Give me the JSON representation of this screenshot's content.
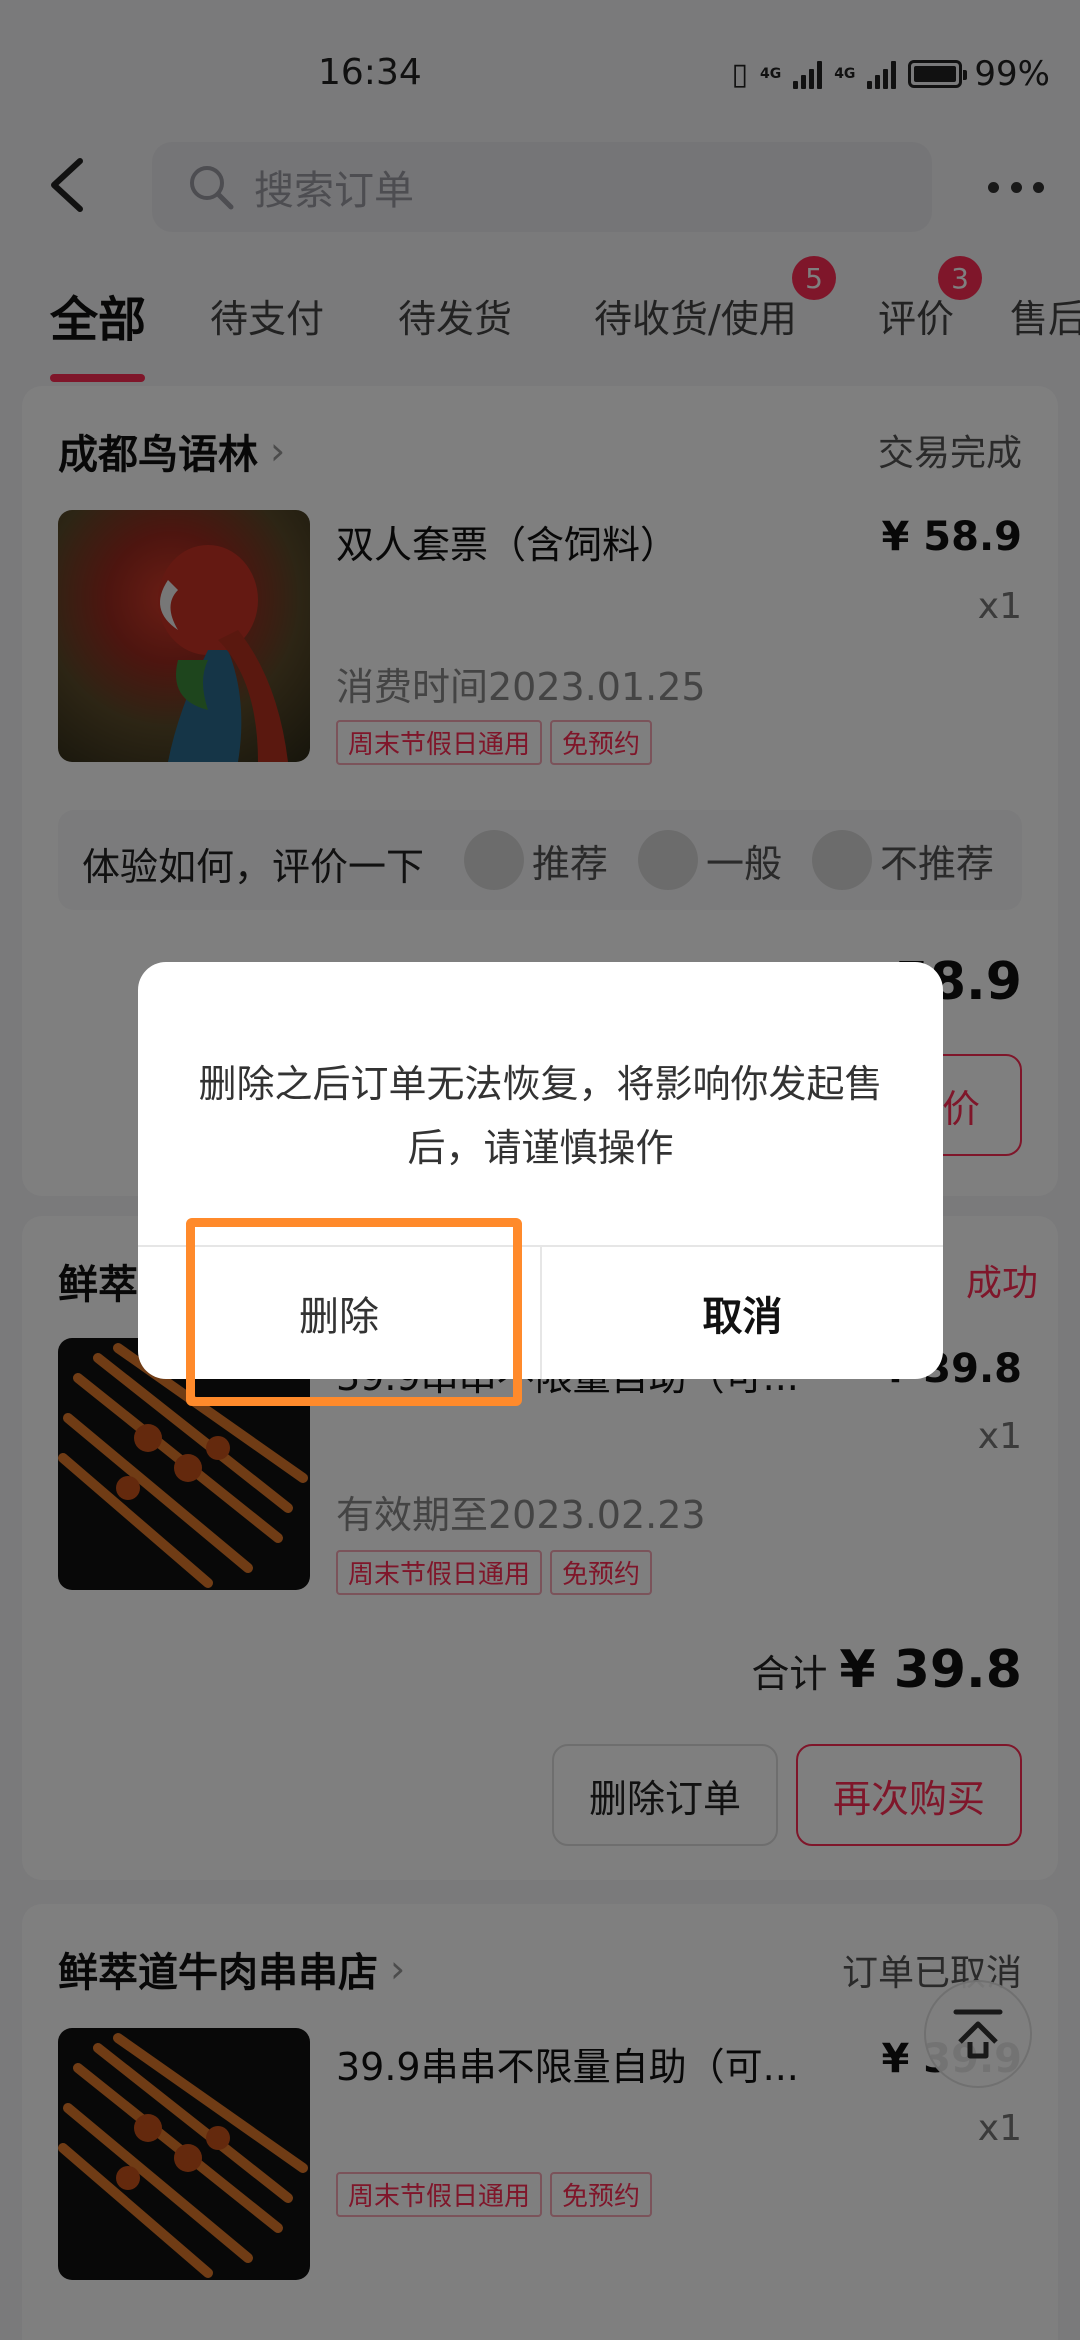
{
  "status_bar": {
    "time": "16:34",
    "battery": "99%",
    "net1": "4G",
    "net2": "4G"
  },
  "search": {
    "placeholder": "搜索订单"
  },
  "tabs": [
    {
      "label": "全部",
      "active": true
    },
    {
      "label": "待支付"
    },
    {
      "label": "待发货"
    },
    {
      "label": "待收货/使用",
      "badge": "5"
    },
    {
      "label": "评价",
      "badge": "3"
    },
    {
      "label": "售后"
    }
  ],
  "orders": [
    {
      "shop": "成都鸟语林",
      "status": "交易完成",
      "product": "双人套票（含饲料）",
      "price": "¥ 58.9",
      "qty": "x1",
      "meta": "消费时间2023.01.25",
      "tags": [
        "周末节假日通用",
        "免预约"
      ],
      "review_prompt": "体验如何，评价一下",
      "review_options": [
        "推荐",
        "一般",
        "不推荐"
      ],
      "total_partial": "58.9",
      "button_partial": "价"
    },
    {
      "shop": "鲜萃",
      "status": "成功",
      "product": "39.9串串不限量自助（可...",
      "price": "¥ 39.8",
      "qty": "x1",
      "meta": "有效期至2023.02.23",
      "tags": [
        "周末节假日通用",
        "免预约"
      ],
      "total_label": "合计",
      "total": "¥ 39.8",
      "buttons": [
        "删除订单",
        "再次购买"
      ]
    },
    {
      "shop": "鲜萃道牛肉串串店",
      "status": "订单已取消",
      "product": "39.9串串不限量自助（可...",
      "price": "¥ 39.9",
      "qty": "x1",
      "tags": [
        "周末节假日通用",
        "免预约"
      ]
    }
  ],
  "dialog": {
    "message": "删除之后订单无法恢复，将影响你发起售后，请谨慎操作",
    "delete_label": "删除",
    "cancel_label": "取消"
  },
  "colors": {
    "accent": "#fe2c55",
    "highlight": "#ff8a2b"
  }
}
